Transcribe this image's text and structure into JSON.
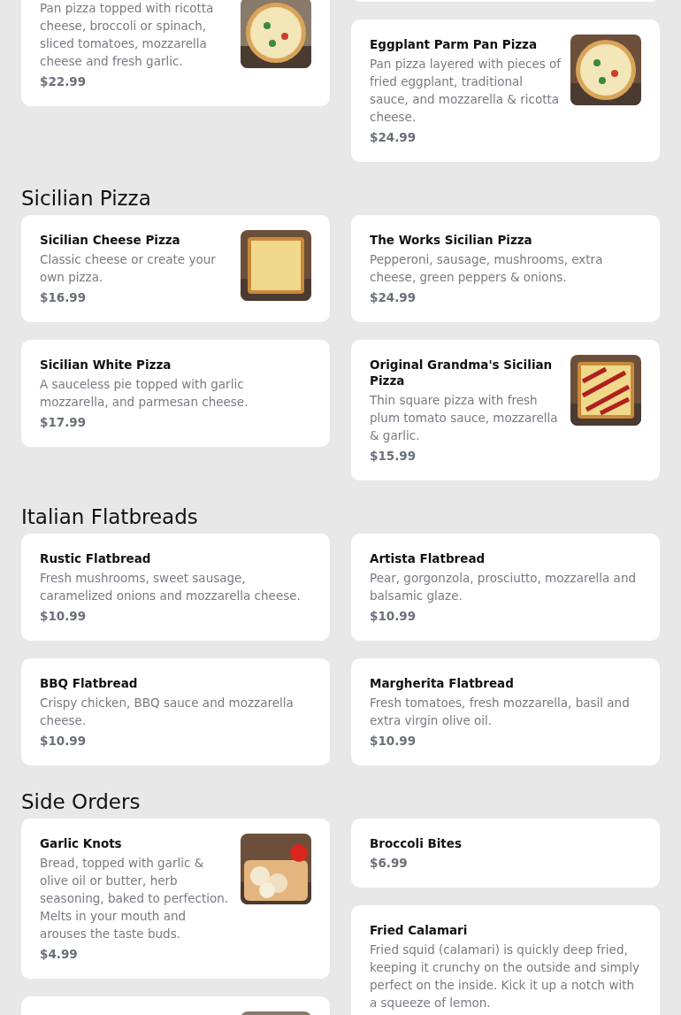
{
  "sections": [
    {
      "columns": [
        [
          {
            "description": "Pan pizza topped with ricotta cheese, broccoli or spinach, sliced tomatoes, mozzarella cheese and fresh garlic.",
            "price": "$22.99",
            "picture": true
          }
        ],
        [
          {
            "name": "Eggplant Parm Pan Pizza",
            "description": "Pan pizza layered with pieces of fried eggplant, traditional sauce, and mozzarella & ricotta cheese.",
            "price": "$24.99",
            "picture": true
          }
        ]
      ]
    },
    {
      "title": "Sicilian Pizza",
      "columns": [
        [
          {
            "name": "Sicilian Cheese Pizza",
            "description": "Classic cheese or create your own pizza.",
            "price": "$16.99",
            "picture": true
          },
          {
            "name": "Sicilian White Pizza",
            "description": "A sauceless pie topped with garlic mozzarella, and parmesan cheese.",
            "price": "$17.99"
          }
        ],
        [
          {
            "name": "The Works Sicilian Pizza",
            "description": "Pepperoni, sausage, mushrooms, extra cheese, green peppers & onions.",
            "price": "$24.99"
          },
          {
            "name": "Original Grandma's Sicilian Pizza",
            "description": "Thin square pizza with fresh plum tomato sauce, mozzarella & garlic.",
            "price": "$15.99",
            "picture": true
          }
        ]
      ]
    },
    {
      "title": "Italian Flatbreads",
      "columns": [
        [
          {
            "name": "Rustic Flatbread",
            "description": "Fresh mushrooms, sweet sausage, caramelized onions and mozzarella cheese.",
            "price": "$10.99"
          },
          {
            "name": "BBQ Flatbread",
            "description": "Crispy chicken, BBQ sauce and mozzarella cheese.",
            "price": "$10.99"
          }
        ],
        [
          {
            "name": "Artista Flatbread",
            "description": "Pear, gorgonzola, prosciutto, mozzarella and balsamic glaze.",
            "price": "$10.99"
          },
          {
            "name": "Margherita Flatbread",
            "description": "Fresh tomatoes, fresh mozzarella, basil and extra virgin olive oil.",
            "price": "$10.99"
          }
        ]
      ]
    },
    {
      "title": "Side Orders",
      "columns": [
        [
          {
            "name": "Garlic Knots",
            "description": "Bread, topped with garlic & olive oil or butter, herb seasoning, baked to perfection. Melts in your mouth and arouses the taste buds.",
            "price": "$4.99",
            "picture": true
          },
          {
            "picture": true
          }
        ],
        [
          {
            "name": "Broccoli Bites",
            "price": "$6.99"
          },
          {
            "name": "Fried Calamari",
            "description": "Fried squid (calamari) is quickly deep fried, keeping it crunchy on the outside and simply perfect on the inside. Kick it up a notch with a squeeze of lemon."
          }
        ]
      ]
    }
  ]
}
